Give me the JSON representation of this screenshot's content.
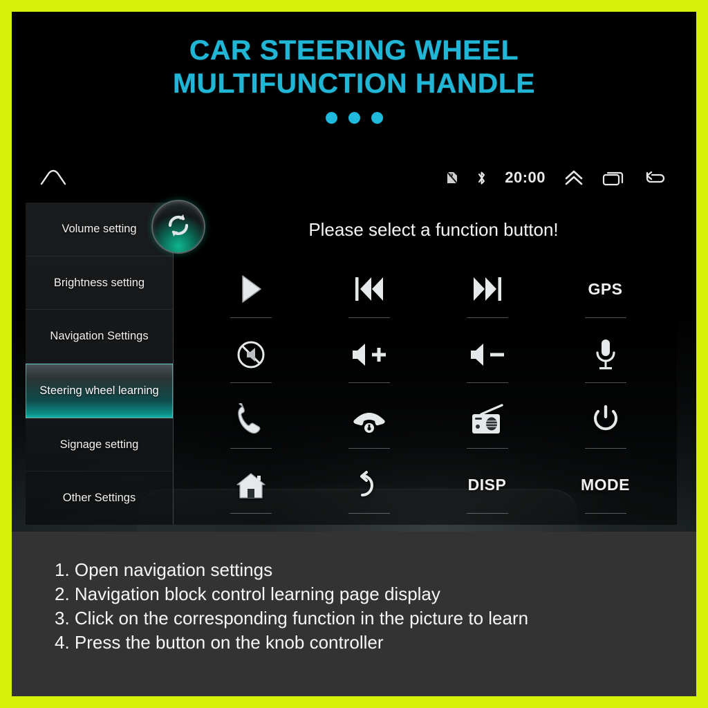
{
  "banner": {
    "title_line1": "CAR STEERING WHEEL",
    "title_line2": "MULTIFUNCTION HANDLE",
    "accent_color": "#21b6d6",
    "border_color": "#d6f20a",
    "dots_count": 3
  },
  "device": {
    "status_bar": {
      "home_icon": "home-outline-icon",
      "sd_icon": "sd-card-icon",
      "bluetooth_icon": "bluetooth-icon",
      "time": "20:00",
      "expand_icon": "double-chevron-up-icon",
      "recents_icon": "recent-apps-icon",
      "back_icon": "back-arrow-icon"
    },
    "sidebar": {
      "items": [
        {
          "label": "Volume setting",
          "selected": false
        },
        {
          "label": "Brightness setting",
          "selected": false
        },
        {
          "label": "Navigation Settings",
          "selected": false
        },
        {
          "label": "Steering wheel learning",
          "selected": true
        },
        {
          "label": "Signage setting",
          "selected": false
        },
        {
          "label": "Other Settings",
          "selected": false
        }
      ],
      "selected_color": "#12b3a6"
    },
    "content": {
      "sync_icon": "sync-refresh-icon",
      "prompt": "Please select a function button!",
      "buttons": [
        {
          "icon": "play-icon",
          "label": ""
        },
        {
          "icon": "previous-track-icon",
          "label": ""
        },
        {
          "icon": "next-track-icon",
          "label": ""
        },
        {
          "icon": "gps-icon",
          "label": "GPS"
        },
        {
          "icon": "mute-icon",
          "label": ""
        },
        {
          "icon": "volume-up-icon",
          "label": ""
        },
        {
          "icon": "volume-down-icon",
          "label": ""
        },
        {
          "icon": "microphone-icon",
          "label": ""
        },
        {
          "icon": "phone-answer-icon",
          "label": ""
        },
        {
          "icon": "phone-hangup-icon",
          "label": ""
        },
        {
          "icon": "radio-icon",
          "label": ""
        },
        {
          "icon": "power-icon",
          "label": ""
        },
        {
          "icon": "home-icon",
          "label": ""
        },
        {
          "icon": "return-back-icon",
          "label": ""
        },
        {
          "icon": "disp-icon",
          "label": "DISP"
        },
        {
          "icon": "mode-icon",
          "label": "MODE"
        }
      ]
    }
  },
  "instructions": {
    "steps": [
      "1. Open navigation settings",
      "2. Navigation block control learning page display",
      "3. Click on the corresponding function in the picture to learn",
      "4. Press the button on the knob controller"
    ]
  }
}
